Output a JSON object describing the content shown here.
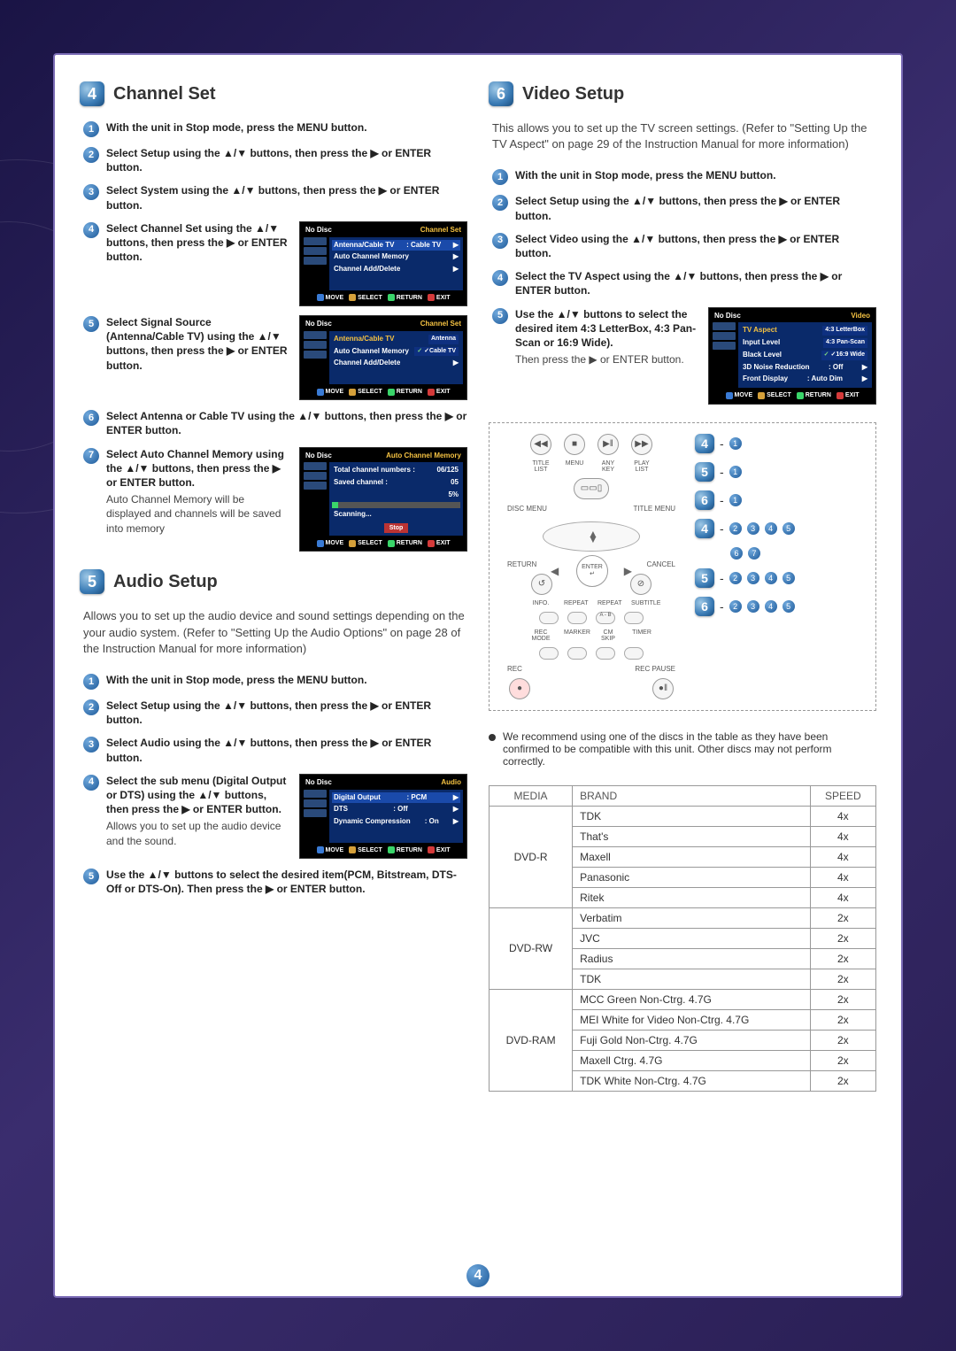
{
  "page_number": "4",
  "sections": {
    "s4": {
      "num": "4",
      "title": "Channel Set",
      "steps": [
        {
          "n": "1",
          "t": "With the unit in Stop mode, press the MENU button."
        },
        {
          "n": "2",
          "t": "Select Setup using the ▲/▼ buttons, then press the ▶ or ENTER button."
        },
        {
          "n": "3",
          "t": "Select System using the ▲/▼ buttons, then press the ▶ or ENTER button."
        },
        {
          "n": "4",
          "t": "Select Channel Set using the ▲/▼ buttons, then press the ▶ or ENTER button."
        },
        {
          "n": "5",
          "t": "Select Signal Source (Antenna/Cable TV) using the ▲/▼ buttons, then press the ▶ or ENTER button."
        },
        {
          "n": "6",
          "t": "Select Antenna or Cable TV using the ▲/▼ buttons, then press the ▶ or ENTER button."
        },
        {
          "n": "7",
          "t": "Select Auto Channel Memory using the ▲/▼ buttons, then press the ▶ or ENTER button.",
          "note": "Auto Channel Memory will be displayed and channels will be saved into memory"
        }
      ],
      "osd1": {
        "head_l": "No Disc",
        "head_r": "Channel Set",
        "rows": [
          [
            "Antenna/Cable TV",
            ": Cable TV",
            "▶"
          ],
          [
            "Auto Channel Memory",
            "",
            "▶"
          ],
          [
            "Channel Add/Delete",
            "",
            "▶"
          ]
        ]
      },
      "osd2": {
        "head_l": "No Disc",
        "head_r": "Channel Set",
        "rows": [
          [
            "Antenna/Cable TV",
            "",
            "Antenna"
          ],
          [
            "Auto Channel Memory",
            "",
            "✓Cable TV"
          ],
          [
            "Channel Add/Delete",
            "",
            "▶"
          ]
        ]
      },
      "osd3": {
        "head_l": "No Disc",
        "head_r": "Auto Channel Memory",
        "total": "Total channel numbers :",
        "total_v": "06/125",
        "saved": "Saved channel :",
        "saved_v": "05",
        "pct": "5%",
        "scan": "Scanning...",
        "stop": "Stop"
      }
    },
    "s5": {
      "num": "5",
      "title": "Audio Setup",
      "intro": "Allows you to set up the audio device and sound settings depending on the your audio system. (Refer to \"Setting Up the Audio Options\" on page 28 of the Instruction Manual for more information)",
      "steps": [
        {
          "n": "1",
          "t": "With the unit in Stop mode, press the MENU button."
        },
        {
          "n": "2",
          "t": "Select Setup using the ▲/▼ buttons, then press the ▶ or ENTER button."
        },
        {
          "n": "3",
          "t": "Select Audio using the ▲/▼ buttons, then press the ▶ or ENTER button."
        },
        {
          "n": "4",
          "t": "Select the sub menu (Digital Output or DTS) using the ▲/▼ buttons, then press the ▶ or ENTER button.",
          "note": "Allows you to set up the audio device and the sound."
        },
        {
          "n": "5",
          "t": "Use the ▲/▼ buttons to select the desired item(PCM, Bitstream, DTS-Off or DTS-On). Then press the ▶ or ENTER button."
        }
      ],
      "osd": {
        "head_l": "No Disc",
        "head_r": "Audio",
        "rows": [
          [
            "Digital Output",
            ": PCM",
            "▶"
          ],
          [
            "DTS",
            ": Off",
            "▶"
          ],
          [
            "Dynamic Compression",
            ": On",
            "▶"
          ]
        ]
      }
    },
    "s6": {
      "num": "6",
      "title": "Video Setup",
      "intro": "This allows you to set up the TV screen settings. (Refer to \"Setting Up the TV Aspect\" on page 29 of the Instruction Manual for more information)",
      "steps": [
        {
          "n": "1",
          "t": "With the unit in Stop mode, press the MENU button."
        },
        {
          "n": "2",
          "t": "Select Setup using the ▲/▼ buttons, then press the ▶ or ENTER button."
        },
        {
          "n": "3",
          "t": "Select Video using the ▲/▼ buttons, then press the ▶ or ENTER button."
        },
        {
          "n": "4",
          "t": "Select the TV Aspect using the ▲/▼ buttons, then press the ▶ or ENTER button."
        },
        {
          "n": "5",
          "t": "Use the ▲/▼ buttons to select the desired item 4:3 LetterBox, 4:3 Pan-Scan or 16:9 Wide).",
          "note": "Then press the ▶ or ENTER button."
        }
      ],
      "osd": {
        "head_l": "No Disc",
        "head_r": "Video",
        "rows": [
          [
            "TV Aspect",
            "",
            "4:3 LetterBox"
          ],
          [
            "Input Level",
            "",
            "4:3 Pan-Scan"
          ],
          [
            "Black Level",
            "",
            "✓16:9 Wide"
          ],
          [
            "3D Noise Reduction",
            ": Off",
            "▶"
          ],
          [
            "Front Display",
            ": Auto Dim",
            "▶"
          ]
        ]
      },
      "remote_labels": {
        "title_list": "TITLE LIST",
        "menu": "MENU",
        "anykey": "ANY KEY",
        "playlist": "PLAY LIST",
        "disc_menu": "DISC MENU",
        "title_menu": "TITLE MENU",
        "enter": "ENTER",
        "return": "RETURN",
        "cancel": "CANCEL",
        "info": "INFO.",
        "repeat": "REPEAT",
        "repeat2": "REPEAT",
        "ab": "A - B",
        "subtitle": "SUBTITLE",
        "recmode": "REC MODE",
        "marker": "MARKER",
        "cmskip": "CM SKIP",
        "timer": "TIMER",
        "rec": "REC",
        "recpause": "REC PAUSE"
      },
      "legend": [
        {
          "big": "4",
          "dash": "-",
          "nums": [
            "1"
          ]
        },
        {
          "big": "5",
          "dash": "-",
          "nums": [
            "1"
          ]
        },
        {
          "big": "6",
          "dash": "-",
          "nums": [
            "1"
          ]
        },
        {
          "big": "4",
          "dash": "-",
          "nums": [
            "2",
            "3",
            "4",
            "5"
          ]
        },
        {
          "big": "",
          "dash": "",
          "nums": [
            "6",
            "7"
          ]
        },
        {
          "big": "5",
          "dash": "-",
          "nums": [
            "2",
            "3",
            "4",
            "5"
          ]
        },
        {
          "big": "6",
          "dash": "-",
          "nums": [
            "2",
            "3",
            "4",
            "5"
          ]
        }
      ],
      "disc_note": "We recommend using one of the discs in the table as they have been confirmed to be compatible with this unit. Other discs may not perform correctly.",
      "table": {
        "headers": [
          "MEDIA",
          "BRAND",
          "SPEED"
        ],
        "rows": [
          {
            "m": "DVD-R",
            "b": "TDK",
            "s": "4x",
            "span": 5
          },
          {
            "m": "",
            "b": "That's",
            "s": "4x"
          },
          {
            "m": "",
            "b": "Maxell",
            "s": "4x"
          },
          {
            "m": "",
            "b": "Panasonic",
            "s": "4x"
          },
          {
            "m": "",
            "b": "Ritek",
            "s": "4x"
          },
          {
            "m": "DVD-RW",
            "b": "Verbatim",
            "s": "2x",
            "span": 4
          },
          {
            "m": "",
            "b": "JVC",
            "s": "2x"
          },
          {
            "m": "",
            "b": "Radius",
            "s": "2x"
          },
          {
            "m": "",
            "b": "TDK",
            "s": "2x"
          },
          {
            "m": "DVD-RAM",
            "b": "MCC Green Non-Ctrg. 4.7G",
            "s": "2x",
            "span": 5
          },
          {
            "m": "",
            "b": "MEI White for Video Non-Ctrg. 4.7G",
            "s": "2x"
          },
          {
            "m": "",
            "b": "Fuji Gold Non-Ctrg. 4.7G",
            "s": "2x"
          },
          {
            "m": "",
            "b": "Maxell Ctrg. 4.7G",
            "s": "2x"
          },
          {
            "m": "",
            "b": "TDK White Non-Ctrg. 4.7G",
            "s": "2x"
          }
        ]
      }
    }
  },
  "osd_foot": {
    "move": "MOVE",
    "select": "SELECT",
    "return": "RETURN",
    "exit": "EXIT"
  }
}
